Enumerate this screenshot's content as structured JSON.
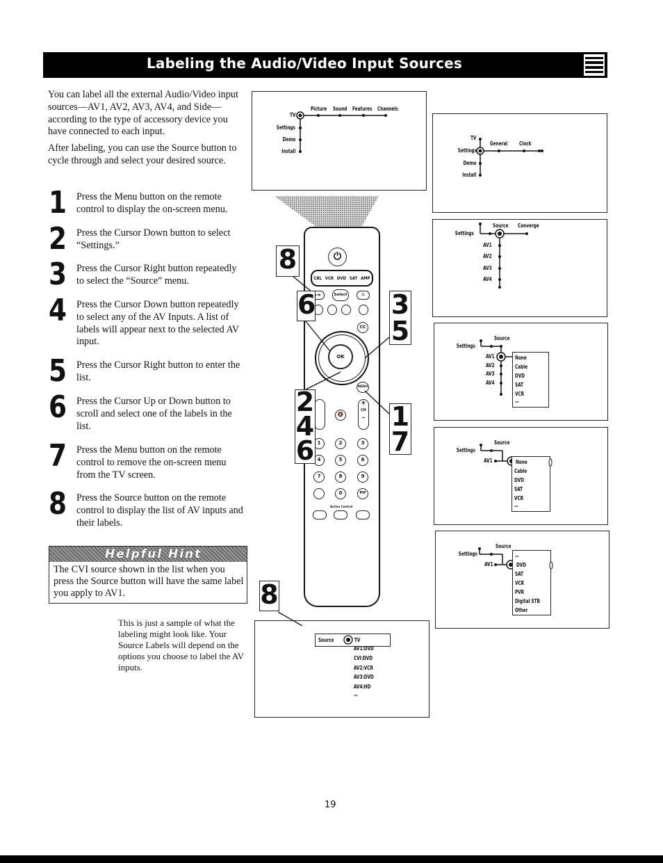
{
  "header": {
    "title": "Labeling the Audio/Video Input Sources",
    "icon": "menu-lines-icon"
  },
  "intro": [
    "You can label all the external Audio/Video input sources—AV1, AV2, AV3, AV4, and Side—according to the type of accessory device you have connected to each input.",
    "After labeling, you can use the Source button to cycle through and select your desired source."
  ],
  "steps": [
    {
      "num": "1",
      "text": "Press the Menu button on the remote control to display the on-screen menu."
    },
    {
      "num": "2",
      "text": "Press the Cursor Down button to select “Settings.”"
    },
    {
      "num": "3",
      "text": "Press the Cursor Right button repeatedly to select the “Source” menu."
    },
    {
      "num": "4",
      "text": "Press the Cursor Down button repeatedly to select any of the AV Inputs. A list of labels will appear next to the selected AV input."
    },
    {
      "num": "5",
      "text": "Press the Cursor Right button to enter the list."
    },
    {
      "num": "6",
      "text": "Press the Cursor Up or Down button to scroll and select one of the labels in the list."
    },
    {
      "num": "7",
      "text": "Press the Menu button on the remote control to remove the on-screen menu from the TV screen."
    },
    {
      "num": "8",
      "text": "Press the Source button on the remote control to display the list of AV inputs and their labels."
    }
  ],
  "hint": {
    "label": "Helpful Hint",
    "text": "The CVI source shown in the list when you press the Source button will have the same label you apply to AV1."
  },
  "caption": "This is just a sample of what the labeling might look like. Your Source Labels will depend on the options you choose to label the AV inputs.",
  "diagrams": {
    "d1": {
      "root": "TV",
      "top": [
        "Picture",
        "Sound",
        "Features",
        "Channels"
      ],
      "side": [
        "Settings",
        "Demo",
        "Install"
      ]
    },
    "d2": {
      "up": "TV",
      "root": "Settings",
      "top": [
        "General",
        "Clock"
      ],
      "side": [
        "Demo",
        "Install"
      ]
    },
    "d3": {
      "left": "Settings",
      "top": [
        "Source",
        "Converge"
      ],
      "side": [
        "AV1",
        "AV2",
        "AV3",
        "AV4"
      ]
    },
    "d4": {
      "left": "Settings",
      "top": "Source",
      "side": [
        "AV1",
        "AV2",
        "AV3",
        "AV4"
      ],
      "list": [
        "None",
        "Cable",
        "DVD",
        "SAT",
        "VCR",
        "—"
      ]
    },
    "d5": {
      "left": "Settings",
      "top": "Source",
      "side": "AV1",
      "list": [
        "None",
        "Cable",
        "DVD",
        "SAT",
        "VCR",
        "—"
      ]
    },
    "d6": {
      "left": "Settings",
      "top": "Source",
      "side": "AV1",
      "list": [
        "—",
        "DVD",
        "SAT",
        "VCR",
        "PVR",
        "Digital STB",
        "Other"
      ]
    },
    "d7": {
      "label": "Source",
      "current": "TV",
      "list": [
        "AV1:DVD",
        "CVI:DVD",
        "AV2:VCR",
        "AV3:DVD",
        "AV4:HD",
        "—"
      ]
    }
  },
  "remote": {
    "modes": [
      "CBL",
      "VCR",
      "DVD",
      "SAT",
      "AMP"
    ],
    "select": "Select",
    "ok": "OK",
    "cc": "CC",
    "menu": "MENU",
    "ch": "CH",
    "plus": "+",
    "minus": "–",
    "numbers": [
      "1",
      "2",
      "3",
      "4",
      "5",
      "6",
      "7",
      "8",
      "9",
      "",
      "0",
      "PiP"
    ],
    "active_control": "Active Control"
  },
  "callouts": [
    "8",
    "6",
    "3\n5",
    "2\n4\n6",
    "1\n7",
    "8"
  ],
  "page_number": "19"
}
